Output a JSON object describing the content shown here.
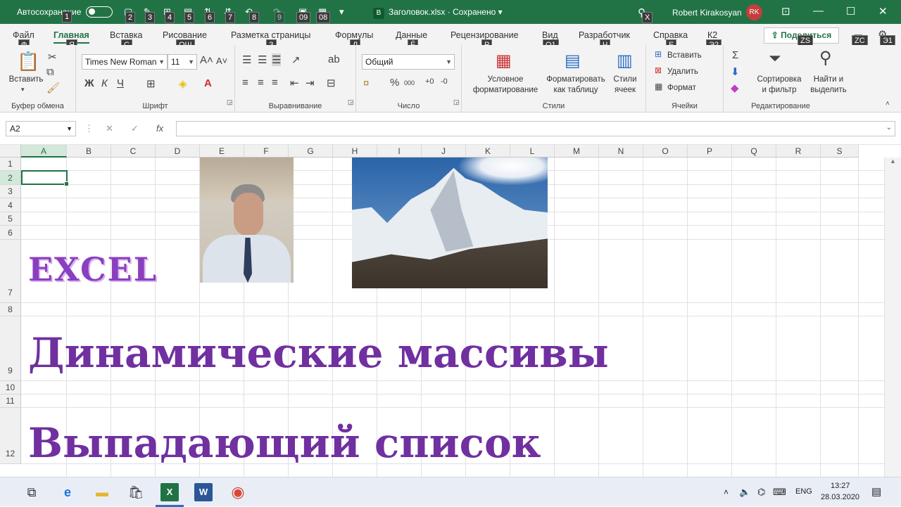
{
  "titlebar": {
    "autosave_label": "Автосохранение",
    "doc_badge": "B",
    "doc_title": "Заголовок.xlsx · Сохранено ▾",
    "user_name": "Robert Kirakosyan",
    "user_initials": "RK",
    "keytips": [
      "1",
      "2",
      "3",
      "4",
      "5",
      "6",
      "7",
      "8",
      "9",
      "09",
      "08",
      "X"
    ]
  },
  "tabs": [
    {
      "label": "Файл",
      "keytip": "Ф"
    },
    {
      "label": "Главная",
      "keytip": "Я"
    },
    {
      "label": "Вставка",
      "keytip": "С"
    },
    {
      "label": "Рисование",
      "keytip": "ОШ"
    },
    {
      "label": "Разметка страницы",
      "keytip": "З"
    },
    {
      "label": "Формулы",
      "keytip": "Л"
    },
    {
      "label": "Данные",
      "keytip": "Ё"
    },
    {
      "label": "Рецензирование",
      "keytip": "Р"
    },
    {
      "label": "Вид",
      "keytip": "О1"
    },
    {
      "label": "Разработчик",
      "keytip": "Ч"
    },
    {
      "label": "Справка",
      "keytip": "Е"
    },
    {
      "label": "К2",
      "keytip": "Э2"
    }
  ],
  "share": {
    "label": "Поделиться",
    "keytip": "ZS"
  },
  "extra_keytips": [
    "ZC",
    "Э1"
  ],
  "ribbon": {
    "clipboard": {
      "label": "Буфер обмена",
      "paste": "Вставить"
    },
    "font": {
      "label": "Шрифт",
      "name": "Times New Roman",
      "size": "11",
      "bold": "Ж",
      "italic": "К",
      "underline": "Ч"
    },
    "alignment": {
      "label": "Выравнивание"
    },
    "number": {
      "label": "Число",
      "format": "Общий"
    },
    "styles": {
      "label": "Стили",
      "conditional": "Условное\nформатирование",
      "as_table": "Форматировать\nкак таблицу",
      "cell_styles": "Стили\nячеек"
    },
    "cells": {
      "label": "Ячейки",
      "insert": "Вставить",
      "delete": "Удалить",
      "format": "Формат"
    },
    "editing": {
      "label": "Редактирование",
      "sort": "Сортировка\nи фильтр",
      "find": "Найти и\nвыделить"
    }
  },
  "formula_bar": {
    "name_box": "A2",
    "fx": "fx",
    "value": ""
  },
  "sheet": {
    "columns": [
      "A",
      "B",
      "C",
      "D",
      "E",
      "F",
      "G",
      "H",
      "I",
      "J",
      "K",
      "L",
      "M",
      "N",
      "O",
      "P",
      "Q",
      "R",
      "S"
    ],
    "rows": [
      "1",
      "2",
      "3",
      "4",
      "5",
      "6",
      "7",
      "8",
      "9",
      "10",
      "11",
      "12"
    ],
    "active_column": "A",
    "active_row": "2",
    "excel_text": "EXCEL",
    "heading1": "Динамические массивы",
    "heading2": "Выпадающий список"
  },
  "taskbar": {
    "lang": "ENG",
    "time": "13:27",
    "date": "28.03.2020"
  }
}
